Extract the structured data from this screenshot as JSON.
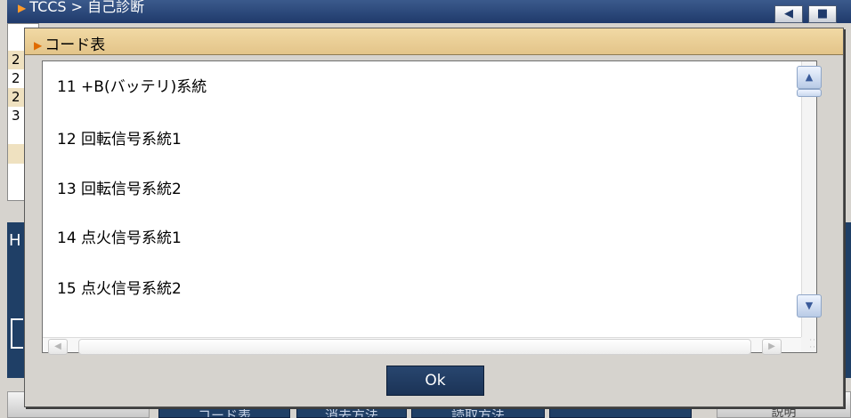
{
  "background": {
    "window_title": "TCCS > 自己診断",
    "row_numbers": [
      "2",
      "2",
      "2",
      "3"
    ],
    "left_panel_text": "H",
    "bottom_buttons": [
      "コード表",
      "消去方法",
      "読取方法"
    ],
    "help_button": "説明"
  },
  "dialog": {
    "title": "コード表",
    "items": [
      "11 +B(バッテリ)系統",
      "12 回転信号系統1",
      "13 回転信号系統2",
      "14 点火信号系統1",
      "15 点火信号系統2"
    ],
    "ok_label": "Ok"
  },
  "colors": {
    "title_bar_gold": "#e8cd94",
    "navy": "#1f3f66",
    "dialog_bg": "#d6d3ce"
  }
}
